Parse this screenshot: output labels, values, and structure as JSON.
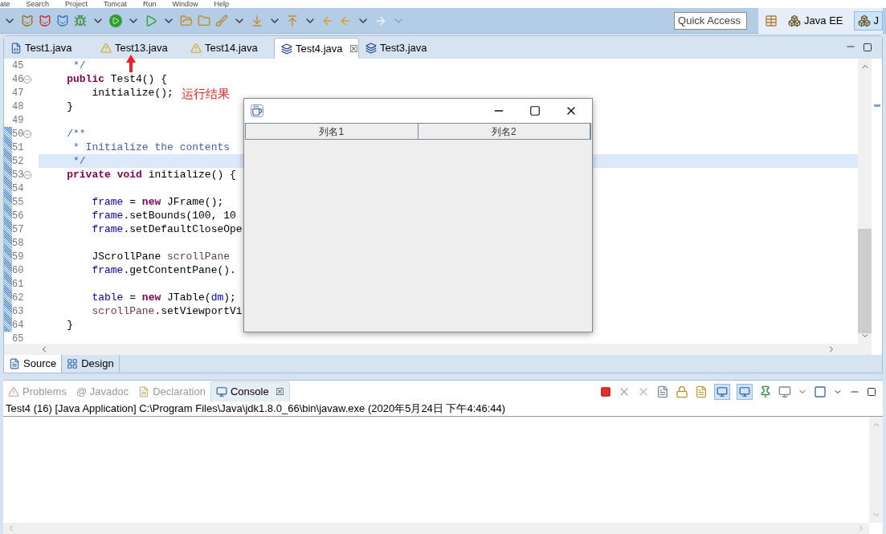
{
  "menu": [
    "ate",
    "Search",
    "Project",
    "Tomcat",
    "Run",
    "Window",
    "Help"
  ],
  "quick_access": {
    "placeholder": "Quick Access"
  },
  "perspectives": [
    {
      "label": "Java EE",
      "selected": false
    },
    {
      "label": "J",
      "selected": true
    }
  ],
  "editor_tabs": [
    {
      "label": "Test1.java",
      "kind": "file",
      "selected": false
    },
    {
      "label": "Test13.java",
      "kind": "warning",
      "selected": false
    },
    {
      "label": "Test14.java",
      "kind": "warning",
      "selected": false
    },
    {
      "label": "Test4.java",
      "kind": "class",
      "selected": true,
      "close": "☒"
    },
    {
      "label": "Test3.java",
      "kind": "class",
      "selected": false
    }
  ],
  "code_lines": [
    {
      "number": "45",
      "foldable": false,
      "changed": false,
      "current": false,
      "segments": [
        {
          "t": "     */",
          "kind": "javadoc"
        }
      ]
    },
    {
      "number": "46",
      "foldable": true,
      "changed": false,
      "current": false,
      "segments": [
        {
          "t": "    public",
          "kind": "keyword"
        },
        {
          "t": " Test4() {",
          "kind": "plain"
        }
      ]
    },
    {
      "number": "47",
      "foldable": false,
      "changed": false,
      "current": false,
      "segments": [
        {
          "t": "        initialize();",
          "kind": "plain"
        }
      ]
    },
    {
      "number": "48",
      "foldable": false,
      "changed": false,
      "current": false,
      "segments": [
        {
          "t": "    }",
          "kind": "plain"
        }
      ]
    },
    {
      "number": "49",
      "foldable": false,
      "changed": false,
      "current": false
    },
    {
      "number": "50",
      "foldable": true,
      "changed": true,
      "current": false,
      "segments": [
        {
          "t": "    /**",
          "kind": "javadoc"
        }
      ]
    },
    {
      "number": "51",
      "foldable": false,
      "changed": true,
      "current": false,
      "segments": [
        {
          "t": "     * Initialize the contents",
          "kind": "javadoc"
        }
      ]
    },
    {
      "number": "52",
      "foldable": false,
      "changed": true,
      "current": true,
      "segments": [
        {
          "t": "     */",
          "kind": "javadoc"
        }
      ]
    },
    {
      "number": "53",
      "foldable": true,
      "changed": true,
      "current": false,
      "segments": [
        {
          "t": "    private",
          "kind": "keyword"
        },
        {
          "t": " void",
          "kind": "keyword"
        },
        {
          "t": " initialize() {",
          "kind": "plain"
        }
      ]
    },
    {
      "number": "54",
      "foldable": false,
      "changed": true,
      "current": false
    },
    {
      "number": "55",
      "foldable": false,
      "changed": true,
      "current": false,
      "segments": [
        {
          "t": "        frame",
          "kind": "field"
        },
        {
          "t": " = ",
          "kind": "plain"
        },
        {
          "t": "new",
          "kind": "keyword"
        },
        {
          "t": " JFrame();",
          "kind": "plain"
        }
      ]
    },
    {
      "number": "56",
      "foldable": false,
      "changed": true,
      "current": false,
      "segments": [
        {
          "t": "        frame",
          "kind": "field"
        },
        {
          "t": ".setBounds(100, 10",
          "kind": "plain"
        }
      ]
    },
    {
      "number": "57",
      "foldable": false,
      "changed": true,
      "current": false,
      "segments": [
        {
          "t": "        frame",
          "kind": "field"
        },
        {
          "t": ".setDefaultCloseOpe",
          "kind": "plain"
        }
      ]
    },
    {
      "number": "58",
      "foldable": false,
      "changed": true,
      "current": false
    },
    {
      "number": "59",
      "foldable": false,
      "changed": true,
      "current": false,
      "segments": [
        {
          "t": "        JScrollPane ",
          "kind": "plain"
        },
        {
          "t": "scrollPane",
          "kind": "local"
        }
      ]
    },
    {
      "number": "60",
      "foldable": false,
      "changed": true,
      "current": false,
      "segments": [
        {
          "t": "        frame",
          "kind": "field"
        },
        {
          "t": ".getContentPane().",
          "kind": "plain"
        }
      ]
    },
    {
      "number": "61",
      "foldable": false,
      "changed": true,
      "current": false
    },
    {
      "number": "62",
      "foldable": false,
      "changed": true,
      "current": false,
      "segments": [
        {
          "t": "        table",
          "kind": "field"
        },
        {
          "t": " = ",
          "kind": "plain"
        },
        {
          "t": "new",
          "kind": "keyword"
        },
        {
          "t": " JTable(",
          "kind": "plain"
        },
        {
          "t": "dm",
          "kind": "field"
        },
        {
          "t": ");",
          "kind": "plain"
        }
      ]
    },
    {
      "number": "63",
      "foldable": false,
      "changed": true,
      "current": false,
      "segments": [
        {
          "t": "        scrollPane",
          "kind": "local"
        },
        {
          "t": ".setViewportVi",
          "kind": "plain"
        }
      ]
    },
    {
      "number": "64",
      "foldable": false,
      "changed": true,
      "current": false,
      "segments": [
        {
          "t": "    }",
          "kind": "plain"
        }
      ]
    },
    {
      "number": "65",
      "foldable": false,
      "changed": false,
      "current": false
    }
  ],
  "annotation": {
    "text": "运行结果"
  },
  "swing_window": {
    "columns": [
      "列名1",
      "列名2"
    ]
  },
  "editor_mode_tabs": [
    {
      "label": "Source",
      "selected": true
    },
    {
      "label": "Design",
      "selected": false
    }
  ],
  "panel_tabs": [
    {
      "label": "Problems",
      "selected": false
    },
    {
      "label": "@ Javadoc",
      "selected": false
    },
    {
      "label": "Declaration",
      "selected": false
    },
    {
      "label": "Console",
      "selected": true,
      "close": "☒"
    }
  ],
  "console": {
    "title": "Test4 (16) [Java Application] C:\\Program Files\\Java\\jdk1.8.0_66\\bin\\javaw.exe (2020年5月24日 下午4:46:44)"
  }
}
